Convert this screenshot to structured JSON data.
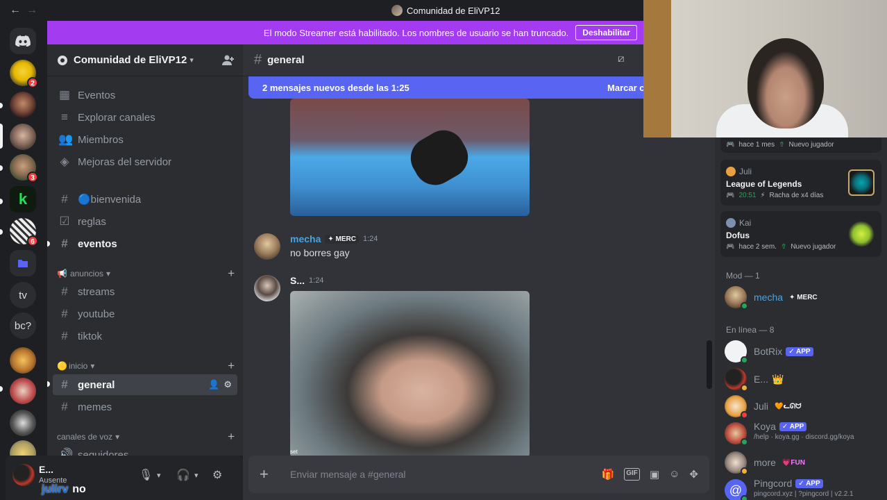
{
  "window": {
    "title": "Comunidad de EliVP12",
    "back": "←",
    "forward": "→"
  },
  "banner": {
    "text": "El modo Streamer está habilitado. Los nombres de usuario se han truncado.",
    "button": "Deshabilitar"
  },
  "rail": {
    "servers": [
      {
        "name": "server-1",
        "badge": "2"
      },
      {
        "name": "server-2",
        "badge": ""
      },
      {
        "name": "server-3",
        "badge": ""
      },
      {
        "name": "server-4",
        "badge": "3"
      },
      {
        "name": "server-5",
        "badge": ""
      },
      {
        "name": "server-6",
        "badge": "6"
      }
    ],
    "text_servers": [
      "tv",
      "bc?"
    ]
  },
  "sidebar": {
    "guild_name": "Comunidad de EliVP12",
    "top_items": [
      "Eventos",
      "Explorar canales",
      "Miembros",
      "Mejoras del servidor"
    ],
    "channels_top": [
      {
        "icon": "#",
        "label": "🔵bienvenida"
      },
      {
        "icon": "☑",
        "label": "reglas"
      },
      {
        "icon": "#",
        "label": "eventos"
      }
    ],
    "cat_anuncios": "anuncios",
    "anuncios_channels": [
      "streams",
      "youtube",
      "tiktok"
    ],
    "cat_inicio": "inicio",
    "inicio_channels": [
      "general",
      "memes"
    ],
    "cat_voz": "canales de voz",
    "voice_channel": "seguidores"
  },
  "user": {
    "name": "E...",
    "status": "Ausente"
  },
  "overlay": {
    "user": "julirv",
    "msg": "no"
  },
  "chat": {
    "channel": "general",
    "new_messages": "2 mensajes nuevos desde las 1:25",
    "mark_read": "Marcar com",
    "messages": [
      {
        "author": "mecha",
        "tag": "MERC",
        "time": "1:24",
        "text": "no borres gay"
      },
      {
        "author": "S...",
        "time": "1:24",
        "text": ""
      }
    ],
    "composer_placeholder": "Enviar mensaje a #general",
    "image_caption": "set"
  },
  "members": {
    "activities": [
      {
        "user": "",
        "game": "",
        "sub1": "hace 1 mes",
        "sub2": "Nuevo jugador"
      },
      {
        "user": "Juli",
        "game": "League of Legends",
        "sub1": "20:51",
        "sub2": "Racha de x4 días"
      },
      {
        "user": "Kai",
        "game": "Dofus",
        "sub1": "hace 2 sem.",
        "sub2": "Nuevo jugador"
      }
    ],
    "mod_header": "Mod — 1",
    "mod": {
      "name": "mecha",
      "tag": "MERC"
    },
    "online_header": "En línea — 8",
    "online": [
      {
        "name": "BotRix",
        "badge": "APP",
        "extra": ""
      },
      {
        "name": "E...",
        "badge": "",
        "extra": "👑"
      },
      {
        "name": "Juli",
        "badge": "",
        "extra": "🧡ᓚᘏᗢ"
      },
      {
        "name": "Koya",
        "badge": "APP",
        "extra": "/help · koya.gg · discord.gg/koya"
      },
      {
        "name": "more",
        "badge": "",
        "extra": "💗FUN"
      },
      {
        "name": "Pingcord",
        "badge": "APP",
        "extra": "pingcord.xyz | ?pingcord | v2.2.1"
      }
    ]
  }
}
